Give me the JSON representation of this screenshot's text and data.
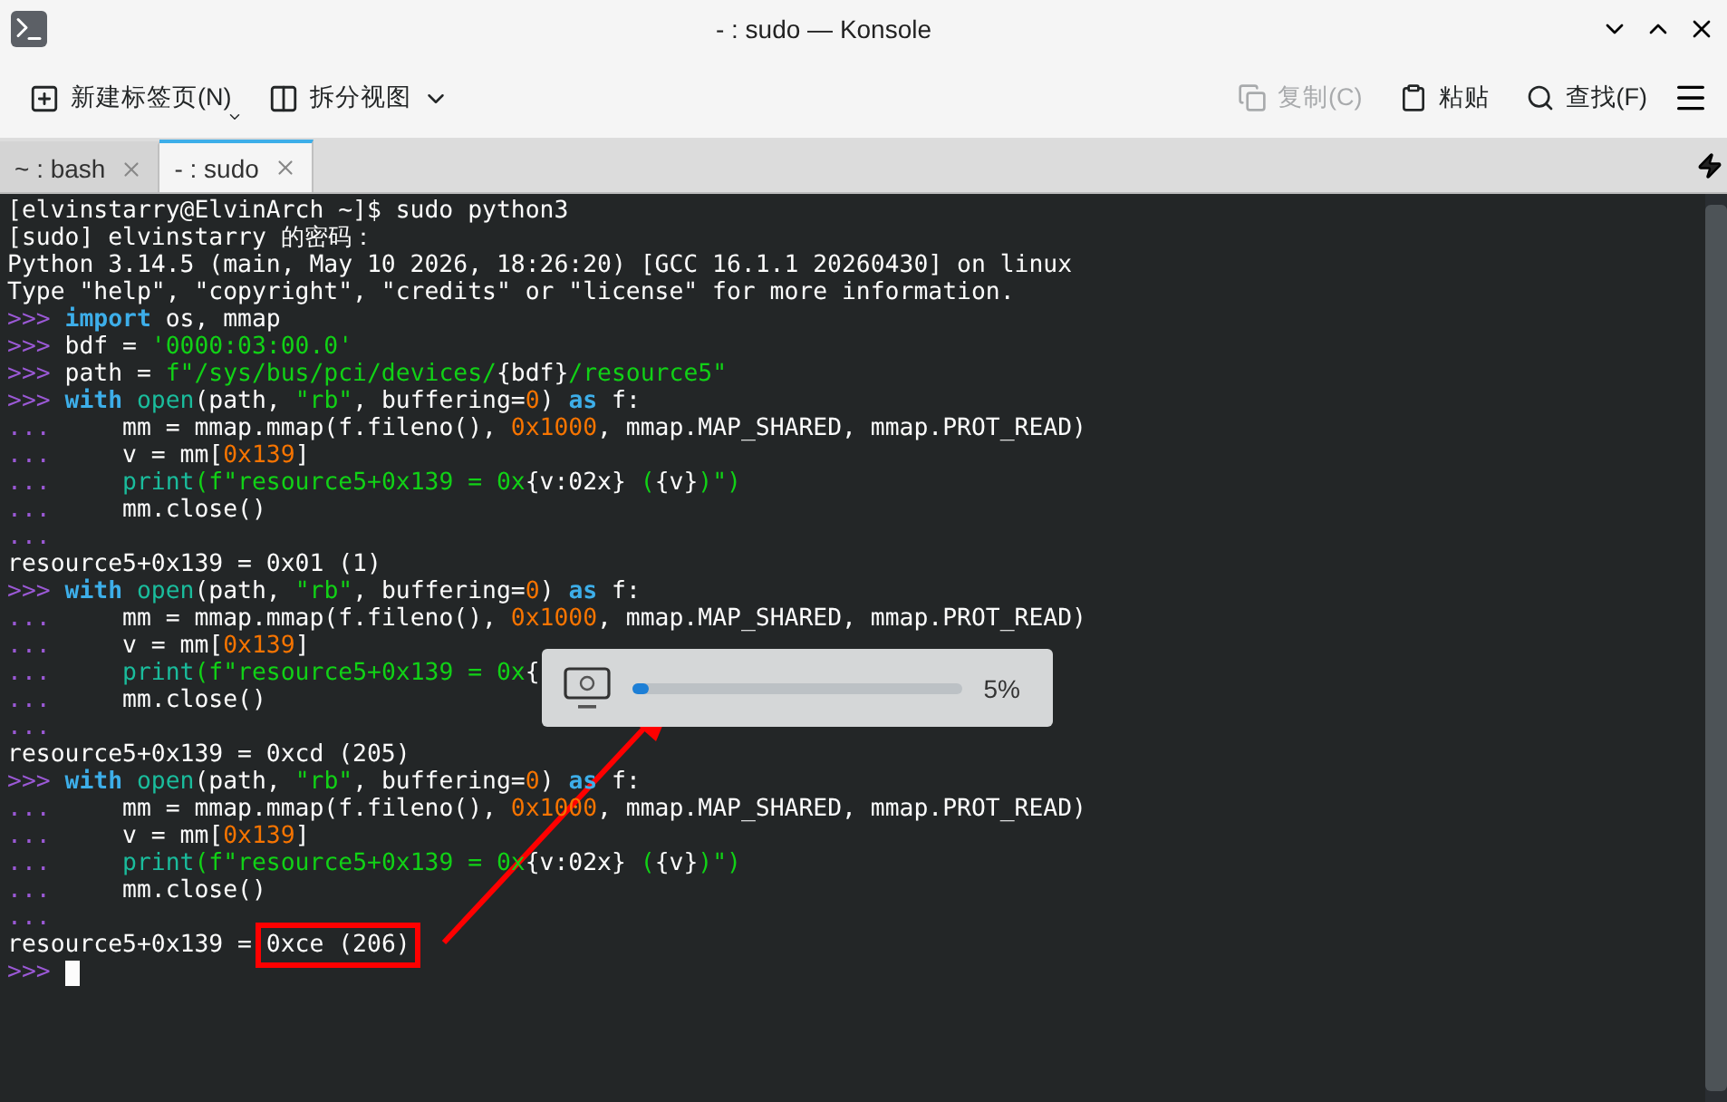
{
  "window": {
    "title": "- : sudo — Konsole"
  },
  "toolbar": {
    "left": [
      {
        "label": "新建标签页(N)",
        "kind": "newtab",
        "disabled": false
      },
      {
        "label": "拆分视图",
        "kind": "split",
        "disabled": false
      }
    ],
    "right": [
      {
        "label": "复制(C)",
        "kind": "copy",
        "disabled": true
      },
      {
        "label": "粘贴",
        "kind": "paste",
        "disabled": false
      },
      {
        "label": "查找(F)",
        "kind": "find",
        "disabled": false
      }
    ]
  },
  "tabs": [
    {
      "label": "~ : bash",
      "selected": false
    },
    {
      "label": "- : sudo",
      "selected": true
    }
  ],
  "terminal": {
    "lines": [
      [
        {
          "text": "[elvinstarry@ElvinArch ~]$ sudo python3",
          "kind": "plain"
        }
      ],
      [
        {
          "text": "[sudo] elvinstarry 的密码：",
          "kind": "plain"
        }
      ],
      [
        {
          "text": "Python 3.14.5 (main, May 10 2026, 18:26:20) [GCC 16.1.1 20260430] on linux",
          "kind": "plain"
        }
      ],
      [
        {
          "text": "Type \"help\", \"copyright\", \"credits\" or \"license\" for more information.",
          "kind": "plain"
        }
      ],
      [
        {
          "text": ">>> ",
          "kind": "prompt"
        },
        {
          "text": "import",
          "kind": "keyword"
        },
        {
          "text": " os, mmap",
          "kind": "plain"
        }
      ],
      [
        {
          "text": ">>> ",
          "kind": "prompt"
        },
        {
          "text": "bdf = ",
          "kind": "plain"
        },
        {
          "text": "'0000:03:00.0'",
          "kind": "string"
        }
      ],
      [
        {
          "text": ">>> ",
          "kind": "prompt"
        },
        {
          "text": "path = ",
          "kind": "plain"
        },
        {
          "text": "f\"/sys/bus/pci/devices/",
          "kind": "string"
        },
        {
          "text": "{bdf}",
          "kind": "plain"
        },
        {
          "text": "/resource5\"",
          "kind": "string"
        }
      ],
      [
        {
          "text": ">>> ",
          "kind": "prompt"
        },
        {
          "text": "with ",
          "kind": "keyword"
        },
        {
          "text": "open",
          "kind": "builtin"
        },
        {
          "text": "(path, ",
          "kind": "plain"
        },
        {
          "text": "\"rb\"",
          "kind": "string"
        },
        {
          "text": ", buffering=",
          "kind": "plain"
        },
        {
          "text": "0",
          "kind": "number"
        },
        {
          "text": ") ",
          "kind": "plain"
        },
        {
          "text": "as",
          "kind": "keyword"
        },
        {
          "text": " f:",
          "kind": "plain"
        }
      ],
      [
        {
          "text": "...     ",
          "kind": "prompt"
        },
        {
          "text": "mm = mmap.mmap(f.fileno(), ",
          "kind": "plain"
        },
        {
          "text": "0x1000",
          "kind": "number"
        },
        {
          "text": ", mmap.MAP_SHARED, mmap.PROT_READ)",
          "kind": "plain"
        }
      ],
      [
        {
          "text": "...     ",
          "kind": "prompt"
        },
        {
          "text": "v = mm[",
          "kind": "plain"
        },
        {
          "text": "0x139",
          "kind": "number"
        },
        {
          "text": "]",
          "kind": "plain"
        }
      ],
      [
        {
          "text": "...     ",
          "kind": "prompt"
        },
        {
          "text": "print",
          "kind": "builtin"
        },
        {
          "text": "(f\"resource5+0x139 = 0x",
          "kind": "string"
        },
        {
          "text": "{v:02x}",
          "kind": "plain"
        },
        {
          "text": " (",
          "kind": "string"
        },
        {
          "text": "{v}",
          "kind": "plain"
        },
        {
          "text": ")\")",
          "kind": "string"
        }
      ],
      [
        {
          "text": "...     ",
          "kind": "prompt"
        },
        {
          "text": "mm.close()",
          "kind": "plain"
        }
      ],
      [
        {
          "text": "...",
          "kind": "prompt"
        }
      ],
      [
        {
          "text": "resource5+0x139 = 0x01 (1)",
          "kind": "plain"
        }
      ],
      [
        {
          "text": ">>> ",
          "kind": "prompt"
        },
        {
          "text": "with ",
          "kind": "keyword"
        },
        {
          "text": "open",
          "kind": "builtin"
        },
        {
          "text": "(path, ",
          "kind": "plain"
        },
        {
          "text": "\"rb\"",
          "kind": "string"
        },
        {
          "text": ", buffering=",
          "kind": "plain"
        },
        {
          "text": "0",
          "kind": "number"
        },
        {
          "text": ") ",
          "kind": "plain"
        },
        {
          "text": "as",
          "kind": "keyword"
        },
        {
          "text": " f:",
          "kind": "plain"
        }
      ],
      [
        {
          "text": "...     ",
          "kind": "prompt"
        },
        {
          "text": "mm = mmap.mmap(f.fileno(), ",
          "kind": "plain"
        },
        {
          "text": "0x1000",
          "kind": "number"
        },
        {
          "text": ", mmap.MAP_SHARED, mmap.PROT_READ)",
          "kind": "plain"
        }
      ],
      [
        {
          "text": "...     ",
          "kind": "prompt"
        },
        {
          "text": "v = mm[",
          "kind": "plain"
        },
        {
          "text": "0x139",
          "kind": "number"
        },
        {
          "text": "]",
          "kind": "plain"
        }
      ],
      [
        {
          "text": "...     ",
          "kind": "prompt"
        },
        {
          "text": "print",
          "kind": "builtin"
        },
        {
          "text": "(f\"resource5+0x139 = 0x",
          "kind": "string"
        },
        {
          "text": "{",
          "kind": "plain"
        }
      ],
      [
        {
          "text": "...     ",
          "kind": "prompt"
        },
        {
          "text": "mm.close()",
          "kind": "plain"
        }
      ],
      [
        {
          "text": "...",
          "kind": "prompt"
        }
      ],
      [
        {
          "text": "resource5+0x139 = 0xcd (205)",
          "kind": "plain"
        }
      ],
      [
        {
          "text": ">>> ",
          "kind": "prompt"
        },
        {
          "text": "with ",
          "kind": "keyword"
        },
        {
          "text": "open",
          "kind": "builtin"
        },
        {
          "text": "(path, ",
          "kind": "plain"
        },
        {
          "text": "\"rb\"",
          "kind": "string"
        },
        {
          "text": ", buffering=",
          "kind": "plain"
        },
        {
          "text": "0",
          "kind": "number"
        },
        {
          "text": ") ",
          "kind": "plain"
        },
        {
          "text": "as",
          "kind": "keyword"
        },
        {
          "text": " f:",
          "kind": "plain"
        }
      ],
      [
        {
          "text": "...     ",
          "kind": "prompt"
        },
        {
          "text": "mm = mmap.mmap(f.fileno(), ",
          "kind": "plain"
        },
        {
          "text": "0x1000",
          "kind": "number"
        },
        {
          "text": ", mmap.MAP_SHARED, mmap.PROT_READ)",
          "kind": "plain"
        }
      ],
      [
        {
          "text": "...     ",
          "kind": "prompt"
        },
        {
          "text": "v = mm[",
          "kind": "plain"
        },
        {
          "text": "0x139",
          "kind": "number"
        },
        {
          "text": "]",
          "kind": "plain"
        }
      ],
      [
        {
          "text": "...     ",
          "kind": "prompt"
        },
        {
          "text": "print",
          "kind": "builtin"
        },
        {
          "text": "(f\"resource5+0x139 = 0x",
          "kind": "string"
        },
        {
          "text": "{v:02x}",
          "kind": "plain"
        },
        {
          "text": " (",
          "kind": "string"
        },
        {
          "text": "{v}",
          "kind": "plain"
        },
        {
          "text": ")\")",
          "kind": "string"
        }
      ],
      [
        {
          "text": "...     ",
          "kind": "prompt"
        },
        {
          "text": "mm.close()",
          "kind": "plain"
        }
      ],
      [
        {
          "text": "...",
          "kind": "prompt"
        }
      ],
      [
        {
          "text": "resource5+0x139 = ",
          "kind": "plain"
        },
        {
          "text": "0xce (206)",
          "kind": "boxed"
        }
      ],
      [
        {
          "text": ">>> ",
          "kind": "prompt"
        },
        {
          "kind": "cursor"
        }
      ]
    ]
  },
  "brightness_osd": {
    "level": 0.05,
    "reading": "5%"
  }
}
